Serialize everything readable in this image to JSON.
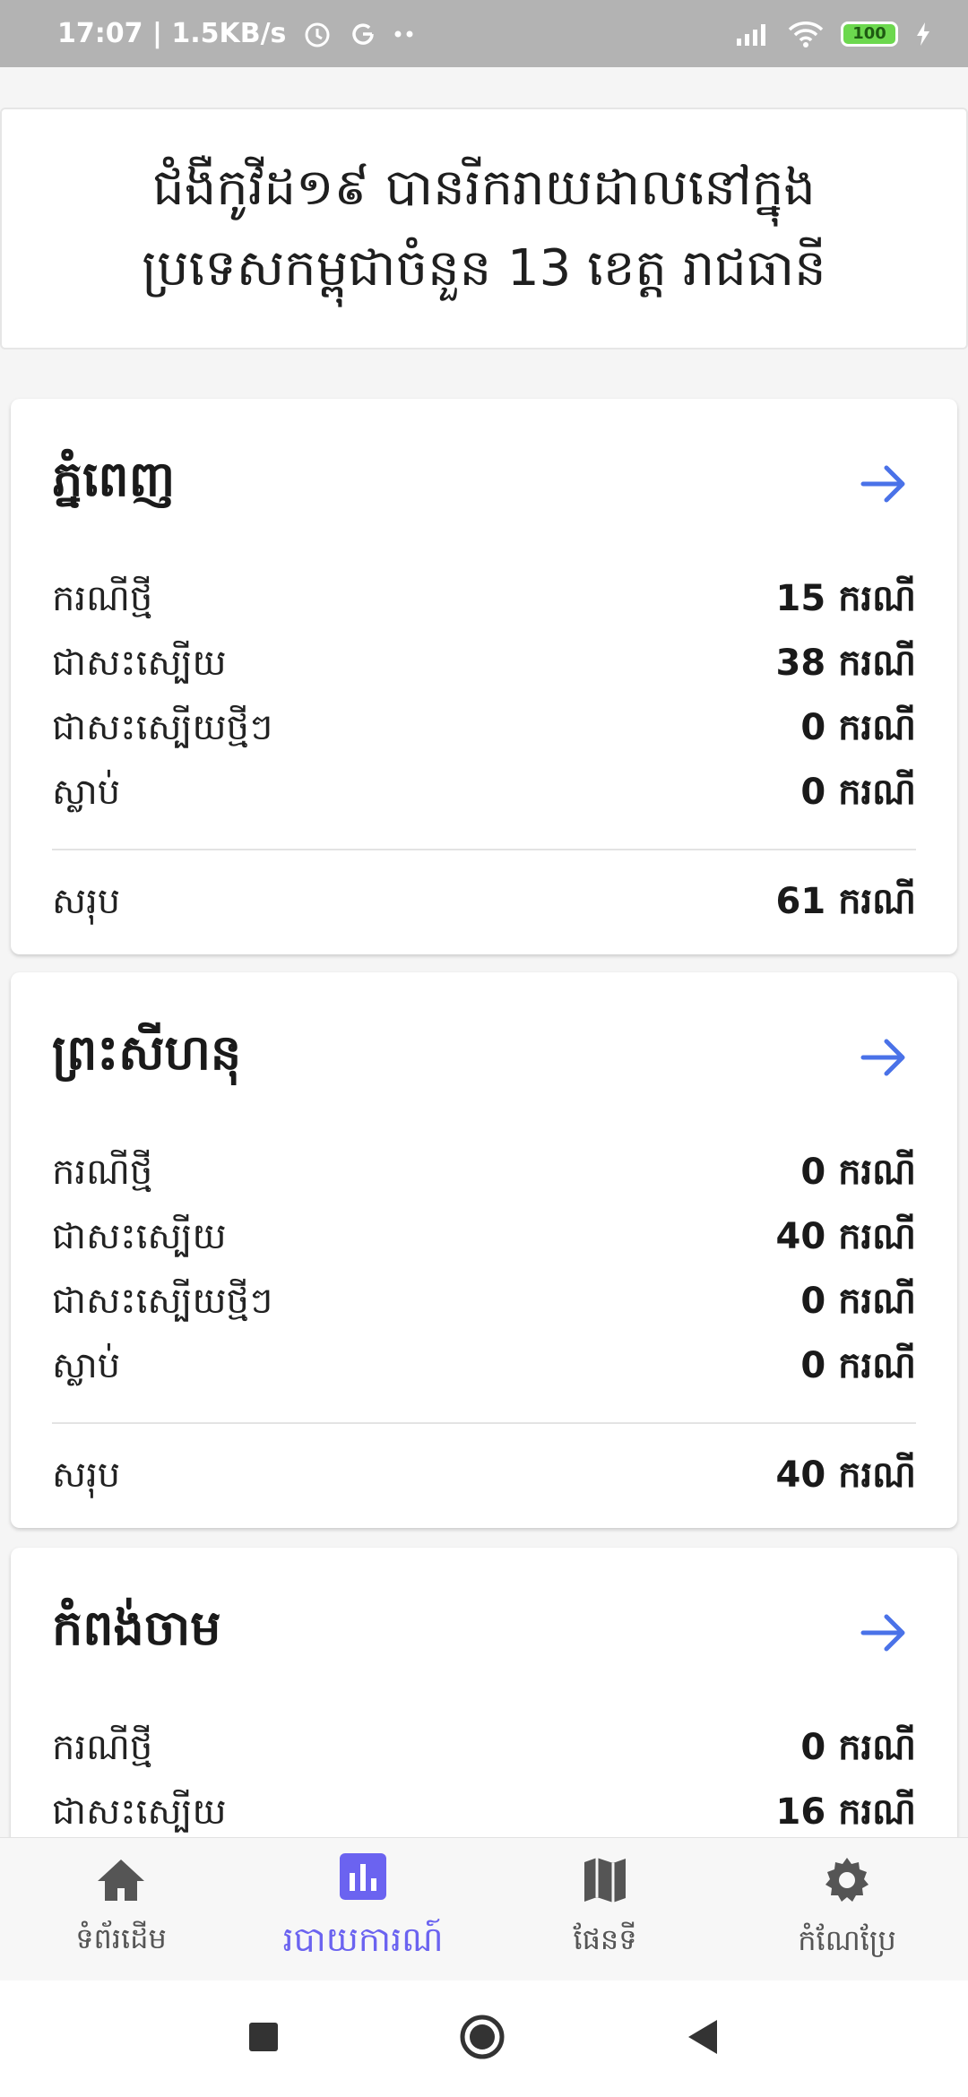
{
  "status_bar": {
    "time_speed": "17:07 | 1.5KB/s",
    "battery": "100",
    "icons": [
      "alarm-icon",
      "g-icon",
      "more-dots-icon",
      "signal-icon",
      "wifi-icon",
      "battery-icon",
      "charging-icon"
    ]
  },
  "header": {
    "title": "ជំងឺកូវីដ១៩ បានរីករាយដាលនៅក្នុង\nប្រទេសកម្ពុជាចំនួន 13 ខេត្ត រាជធានី"
  },
  "provinces": [
    {
      "name": "ភ្នំពេញ",
      "stats": [
        {
          "label": "ករណីថ្មី",
          "value": "15 ករណី"
        },
        {
          "label": "ជាសះស្បើយ",
          "value": "38 ករណី"
        },
        {
          "label": "ជាសះស្បើយថ្មីៗ",
          "value": "0 ករណី"
        },
        {
          "label": "ស្លាប់",
          "value": "0 ករណី"
        }
      ],
      "total_label": "សរុប",
      "total_value": "61 ករណី"
    },
    {
      "name": "ព្រះសីហនុ",
      "stats": [
        {
          "label": "ករណីថ្មី",
          "value": "0 ករណី"
        },
        {
          "label": "ជាសះស្បើយ",
          "value": "40 ករណី"
        },
        {
          "label": "ជាសះស្បើយថ្មីៗ",
          "value": "0 ករណី"
        },
        {
          "label": "ស្លាប់",
          "value": "0 ករណី"
        }
      ],
      "total_label": "សរុប",
      "total_value": "40 ករណី"
    },
    {
      "name": "កំពង់ចាម",
      "stats": [
        {
          "label": "ករណីថ្មី",
          "value": "0 ករណី"
        },
        {
          "label": "ជាសះស្បើយ",
          "value": "16 ករណី"
        }
      ]
    }
  ],
  "bottom_nav": [
    {
      "label": "ទំព័រដើម",
      "icon": "home-icon"
    },
    {
      "label": "របាយការណ៍",
      "icon": "bar-chart-icon"
    },
    {
      "label": "ផែនទី",
      "icon": "map-icon"
    },
    {
      "label": "កំណែប្រែ",
      "icon": "settings-icon"
    }
  ],
  "colors": {
    "accent": "#6b63f0",
    "arrow": "#4a72e8",
    "status_bar": "#b3b3b3"
  }
}
